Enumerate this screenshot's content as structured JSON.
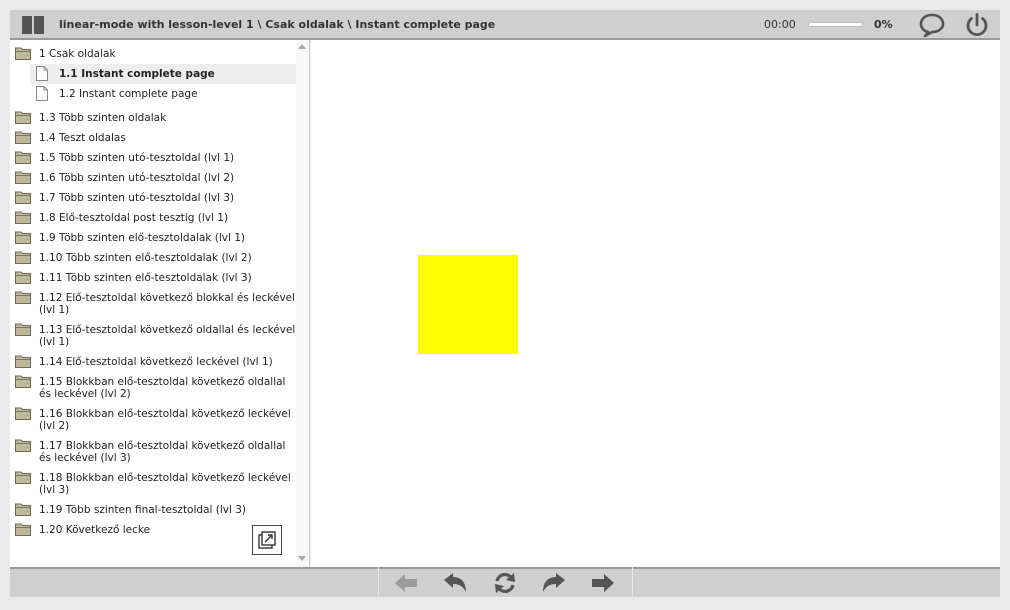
{
  "header": {
    "title": "linear-mode with lesson-level 1 \\ Csak oldalak \\ Instant complete page",
    "timer": "00:00",
    "progress_percent": "0%",
    "progress_fraction": 0
  },
  "toc": {
    "items": [
      {
        "label": "1 Csak oldalak",
        "kind": "folder"
      },
      {
        "label": "1.1 Instant complete page",
        "kind": "page",
        "selected": true
      },
      {
        "label": "1.2 Instant complete page",
        "kind": "page"
      },
      {
        "label": "1.3 Több szinten oldalak",
        "kind": "folder"
      },
      {
        "label": "1.4 Teszt oldalas",
        "kind": "folder"
      },
      {
        "label": "1.5 Több szinten utó-tesztoldal (lvl 1)",
        "kind": "folder"
      },
      {
        "label": "1.6 Több szinten utó-tesztoldal (lvl 2)",
        "kind": "folder"
      },
      {
        "label": "1.7 Több szinten utó-tesztoldal (lvl 3)",
        "kind": "folder"
      },
      {
        "label": "1.8 Elő-tesztoldal post tesztig (lvl 1)",
        "kind": "folder"
      },
      {
        "label": "1.9 Több szinten elő-tesztoldalak (lvl 1)",
        "kind": "folder"
      },
      {
        "label": "1.10 Több szinten elő-tesztoldalak (lvl 2)",
        "kind": "folder"
      },
      {
        "label": "1.11 Több szinten elő-tesztoldalak (lvl 3)",
        "kind": "folder"
      },
      {
        "label": "1.12 Elő-tesztoldal következő blokkal és leckével (lvl 1)",
        "kind": "folder"
      },
      {
        "label": "1.13 Elő-tesztoldal következő oldallal és leckével (lvl 1)",
        "kind": "folder"
      },
      {
        "label": "1.14 Elő-tesztoldal következő leckével (lvl 1)",
        "kind": "folder"
      },
      {
        "label": "1.15 Blokkban elő-tesztoldal következő oldallal és leckével (lvl 2)",
        "kind": "folder"
      },
      {
        "label": "1.16 Blokkban elő-tesztoldal következő leckével (lvl 2)",
        "kind": "folder"
      },
      {
        "label": "1.17 Blokkban elő-tesztoldal következő oldallal és leckével (lvl 3)",
        "kind": "folder"
      },
      {
        "label": "1.18 Blokkban elő-tesztoldal következő leckével (lvl 3)",
        "kind": "folder"
      },
      {
        "label": "1.19 Több szinten final-tesztoldal (lvl 3)",
        "kind": "folder"
      },
      {
        "label": "1.20 Következő lecke",
        "kind": "folder"
      }
    ]
  },
  "icons": {
    "header_left": "book-icon",
    "chat": "chat-bubble-icon",
    "power": "power-icon",
    "popout": "popout-icon",
    "nav": [
      "previous-arrow-icon",
      "undo-icon",
      "reload-icon",
      "redo-icon",
      "next-arrow-icon"
    ]
  },
  "colors": {
    "content_square": "#ffff00",
    "chrome": "#cfcfcf",
    "folder": "#bdb89a"
  }
}
